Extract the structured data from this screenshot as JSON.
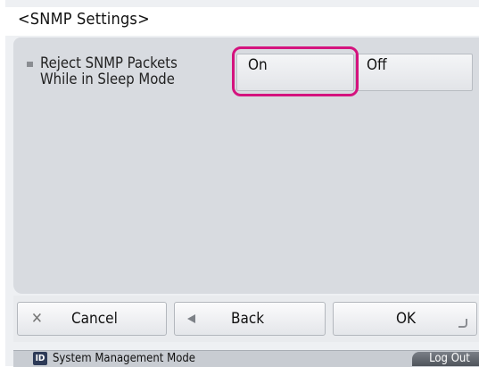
{
  "window": {
    "title": "<SNMP Settings>"
  },
  "setting": {
    "label_line1": "Reject SNMP Packets",
    "label_line2": "While in Sleep Mode",
    "options": [
      {
        "label": "On",
        "selected": true
      },
      {
        "label": "Off",
        "selected": false
      }
    ]
  },
  "footer": {
    "cancel_label": "Cancel",
    "back_label": "Back",
    "ok_label": "OK"
  },
  "status": {
    "mode_icon": "ID",
    "mode_label": "System Management Mode",
    "logout_label": "Log Out"
  },
  "colors": {
    "highlight": "#d4137e",
    "panel": "#d8dbe0"
  }
}
